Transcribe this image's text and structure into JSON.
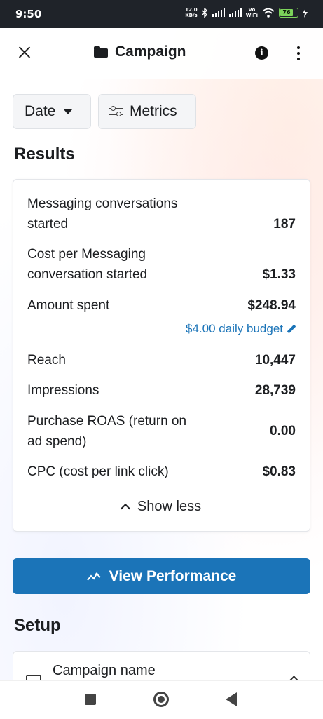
{
  "status_bar": {
    "time": "9:50",
    "net_speed": "12.0",
    "net_unit": "KB/s",
    "volte_top": "Vo",
    "volte_bottom": "WiFi",
    "battery": "76"
  },
  "header": {
    "title": "Campaign",
    "icons": [
      "close-icon",
      "folder-icon",
      "info-icon",
      "more-icon"
    ]
  },
  "filters": {
    "date_label": "Date",
    "metrics_label": "Metrics"
  },
  "results": {
    "title": "Results",
    "rows": [
      {
        "label_line1": "Messaging conversations",
        "label_line2": "started",
        "value": "187"
      },
      {
        "label_line1": "Cost per Messaging",
        "label_line2": "conversation started",
        "value": "$1.33"
      },
      {
        "label_line1": "Amount spent",
        "value": "$248.94"
      },
      {
        "label_line1": "Reach",
        "value": "10,447"
      },
      {
        "label_line1": "Impressions",
        "value": "28,739"
      },
      {
        "label_line1": "Purchase ROAS (return on",
        "label_line2": "ad spend)",
        "value": "0.00"
      },
      {
        "label_line1": "CPC (cost per link click)",
        "value": "$0.83"
      }
    ],
    "budget_text": "$4.00 daily budget",
    "show_less": "Show less"
  },
  "performance_button": "View Performance",
  "setup": {
    "title": "Setup",
    "campaign_name_label": "Campaign name"
  },
  "colors": {
    "accent": "#1b74b8",
    "status_bar": "#1f2329",
    "battery": "#7cd35b"
  }
}
